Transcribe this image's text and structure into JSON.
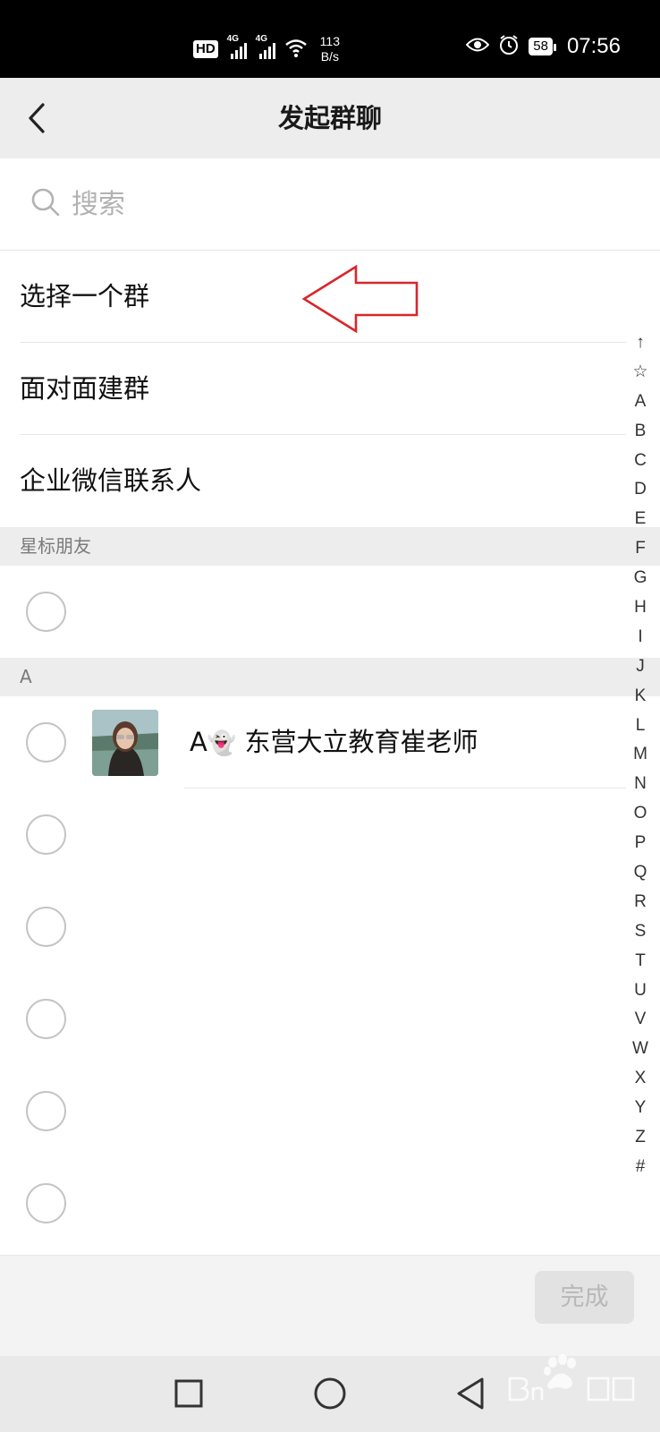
{
  "status_bar": {
    "hd_label": "HD",
    "network_1": "4G",
    "network_2": "4G",
    "speed_value": "113",
    "speed_unit": "B/s",
    "battery": "58",
    "time": "07:56",
    "icons": [
      "eye-icon",
      "alarm-icon",
      "wifi-icon",
      "signal-icon"
    ]
  },
  "header": {
    "title": "发起群聊",
    "back_icon": "chevron-left-icon"
  },
  "search": {
    "placeholder": "搜索",
    "value": ""
  },
  "menu": [
    {
      "label": "选择一个群"
    },
    {
      "label": "面对面建群"
    },
    {
      "label": "企业微信联系人"
    }
  ],
  "sections": {
    "starred": "星标朋友",
    "a": "A"
  },
  "contacts": {
    "starred_count": 1,
    "a_first_name": "A",
    "a_first_emoji": "👻",
    "a_first_rest": "东营大立教育崔老师"
  },
  "alphabet_index": [
    "↑",
    "☆",
    "A",
    "B",
    "C",
    "D",
    "E",
    "F",
    "G",
    "H",
    "I",
    "J",
    "K",
    "L",
    "M",
    "N",
    "O",
    "P",
    "Q",
    "R",
    "S",
    "T",
    "U",
    "V",
    "W",
    "X",
    "Y",
    "Z",
    "#"
  ],
  "footer": {
    "done_label": "完成"
  },
  "navbar": {
    "icons": [
      "square-recents-icon",
      "circle-home-icon",
      "triangle-back-icon"
    ]
  },
  "colors": {
    "annotation_arrow": "#d9262c",
    "header_bg": "#ededed",
    "section_bg": "#ededed"
  }
}
